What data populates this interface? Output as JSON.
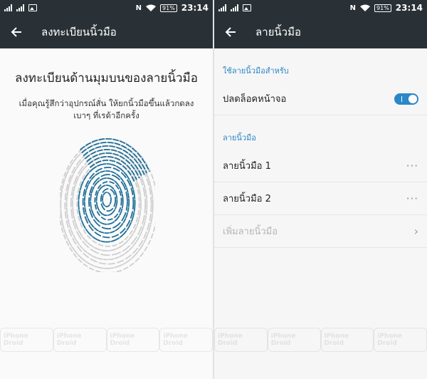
{
  "status_bar": {
    "time": "23:14",
    "battery": "91%",
    "nfc": "N"
  },
  "enroll_screen": {
    "title": "ลงทะเบียนนิ้วมือ",
    "heading": "ลงทะเบียนด้านมุมบนของลายนิ้วมือ",
    "instruction": "เมื่อคุณรู้สึกว่าอุปกรณ์สั่น ให้ยกนิ้วมือขึ้นแล้วกดลงเบาๆ ที่เรด้าอีกครั้ง"
  },
  "fingerprint_screen": {
    "title": "ลายนิ้วมือ",
    "use_section": "ใช้ลายนิ้วมือสำหรับ",
    "unlock_label": "ปลดล็อคหน้าจอ",
    "unlock_on": true,
    "fingerprints_section": "ลายนิ้วมือ",
    "fingerprints": [
      {
        "label": "ลายนิ้วมือ 1"
      },
      {
        "label": "ลายนิ้วมือ 2"
      }
    ],
    "add_label": "เพิ่มลายนิ้วมือ"
  },
  "watermark": "iPhone Droid",
  "colors": {
    "bar": "#2a3136",
    "accent": "#2a87c8",
    "fingerprint_blue": "#1f6f99"
  }
}
